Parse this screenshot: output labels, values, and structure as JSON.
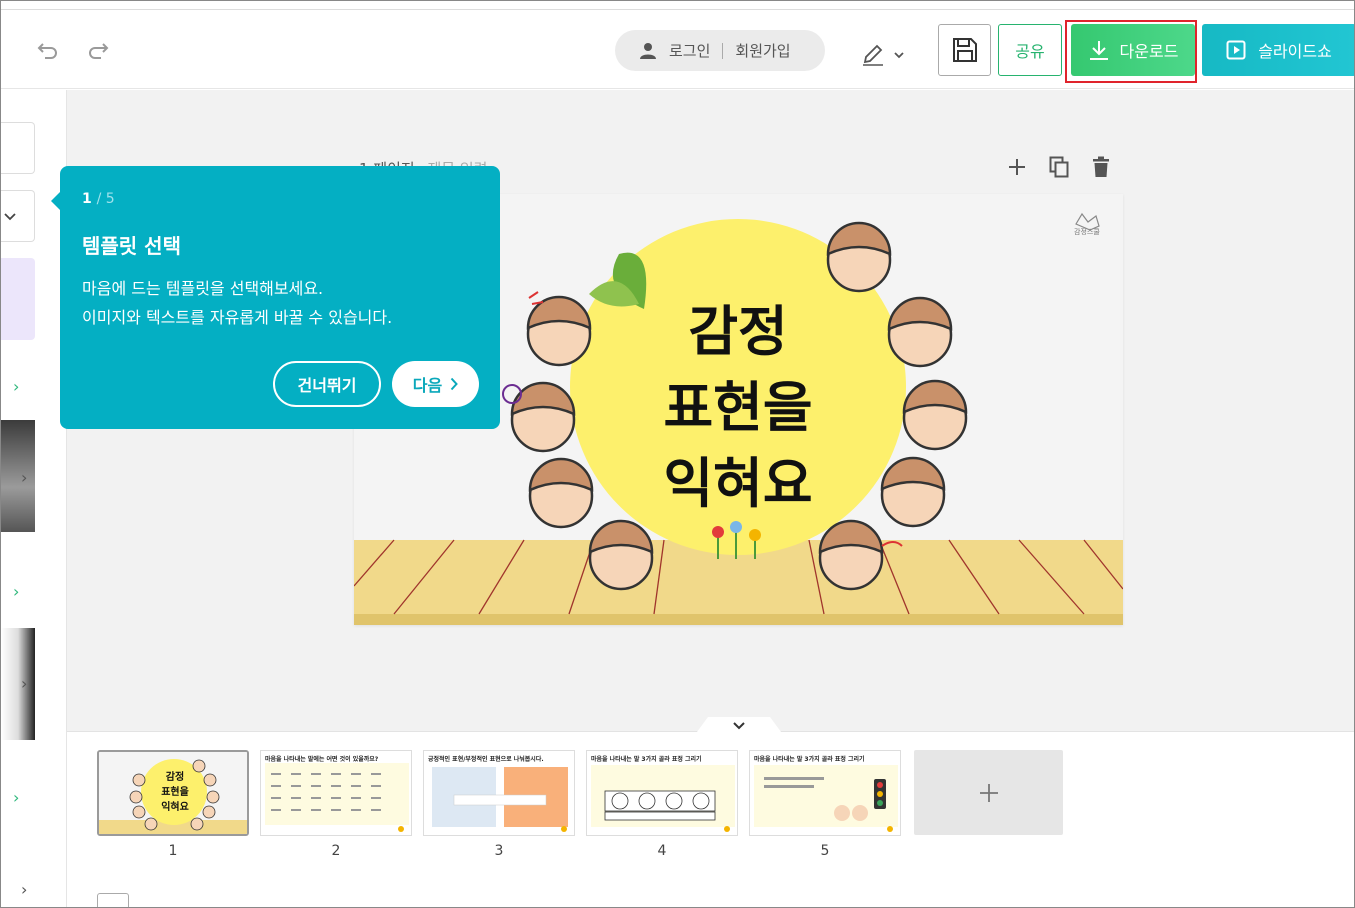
{
  "toolbar": {
    "login_label": "로그인",
    "signup_label": "회원가입",
    "share_label": "공유",
    "download_label": "다운로드",
    "slideshow_label": "슬라이드쇼",
    "colors": {
      "download": "#35c870",
      "slideshow": "#16b9c4",
      "highlight": "#e0242c"
    }
  },
  "page": {
    "label": "1 페이지",
    "title_placeholder": "제목 입력"
  },
  "slide": {
    "title_line1": "감정",
    "title_line2": "표현을",
    "title_line3": "익혀요",
    "brand_mark": "감정스쿨"
  },
  "tour": {
    "step_current": "1",
    "step_total": "5",
    "title": "템플릿 선택",
    "body_line1": "마음에 드는 템플릿을 선택해보세요.",
    "body_line2": "이미지와 텍스트를 자유롭게 바꿀 수 있습니다.",
    "skip_label": "건너뛰기",
    "next_label": "다음"
  },
  "thumbnails": [
    {
      "number": "1",
      "title": "감정 표현을 익혀요"
    },
    {
      "number": "2",
      "title": "마음을 나타내는 말에는 어떤 것이 있을까요?"
    },
    {
      "number": "3",
      "title": "긍정적인 표현/부정적인 표현으로 나눠봅시다."
    },
    {
      "number": "4",
      "title": "마음을 나타내는 말 3가지 골라 표정 그리기"
    },
    {
      "number": "5",
      "title": "마음을 나타내는 말 3가지 골라 표정 그리기"
    }
  ]
}
